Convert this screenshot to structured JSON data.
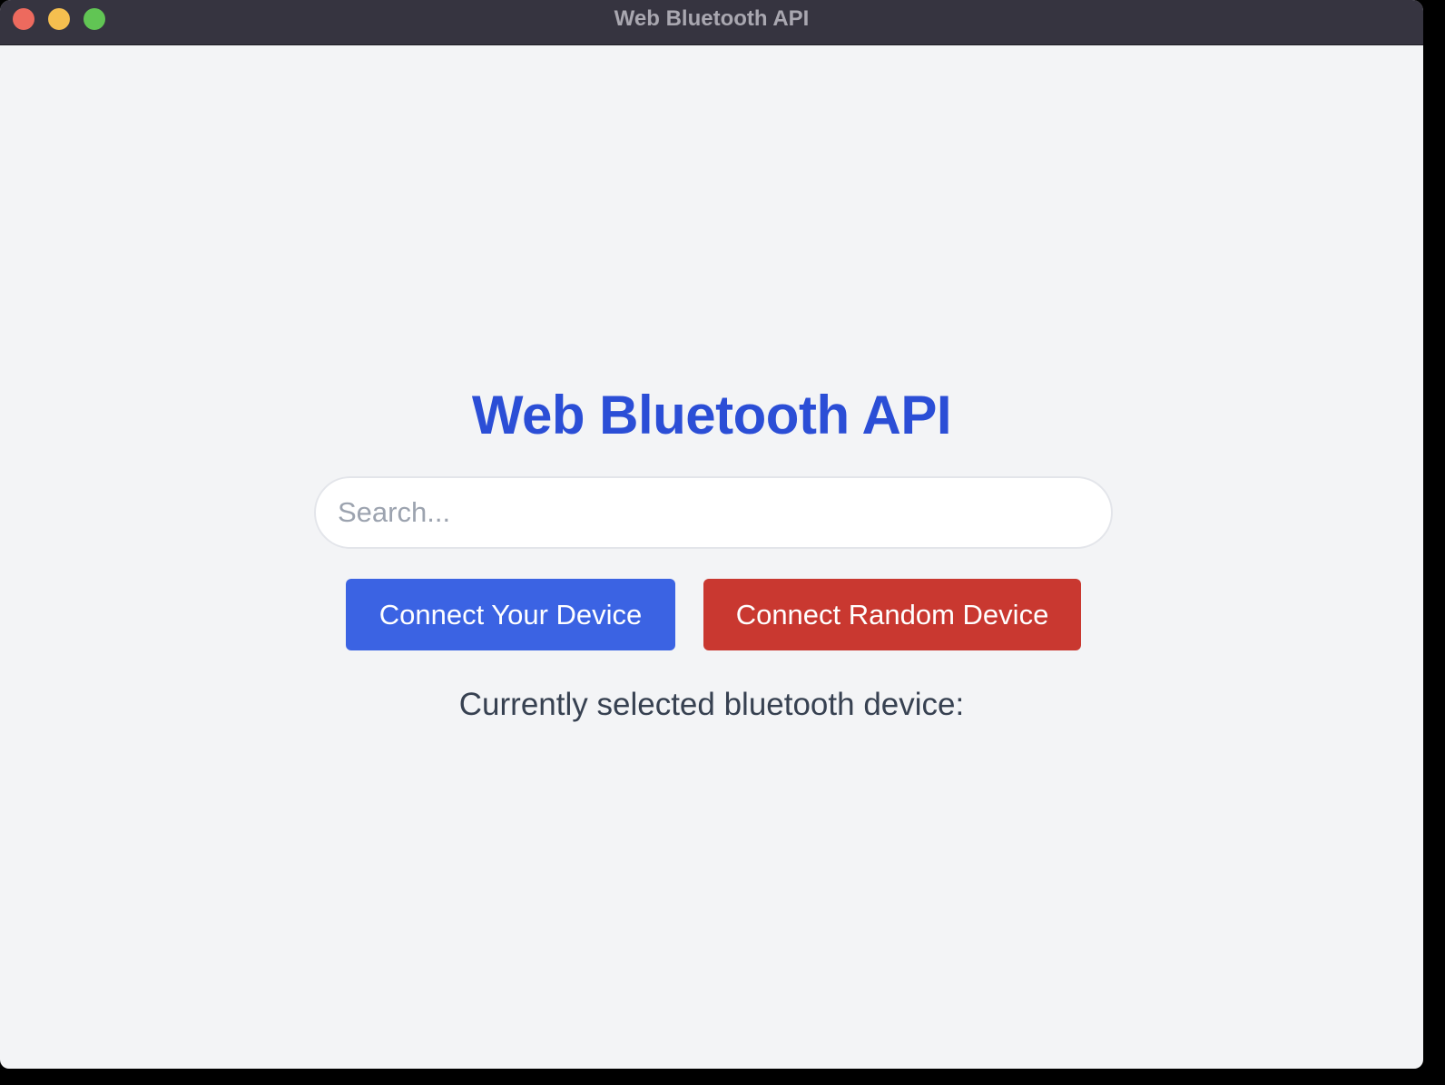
{
  "window": {
    "title": "Web Bluetooth API"
  },
  "main": {
    "heading": "Web Bluetooth API",
    "search": {
      "placeholder": "Search...",
      "value": ""
    },
    "buttons": {
      "connect_your_device": "Connect Your Device",
      "connect_random_device": "Connect Random Device"
    },
    "selected_device_label": "Currently selected bluetooth device:"
  },
  "colors": {
    "heading": "#2b4ed6",
    "primary_button": "#3b63e3",
    "danger_button": "#c93830",
    "background": "#f3f4f6",
    "titlebar": "#363440"
  }
}
